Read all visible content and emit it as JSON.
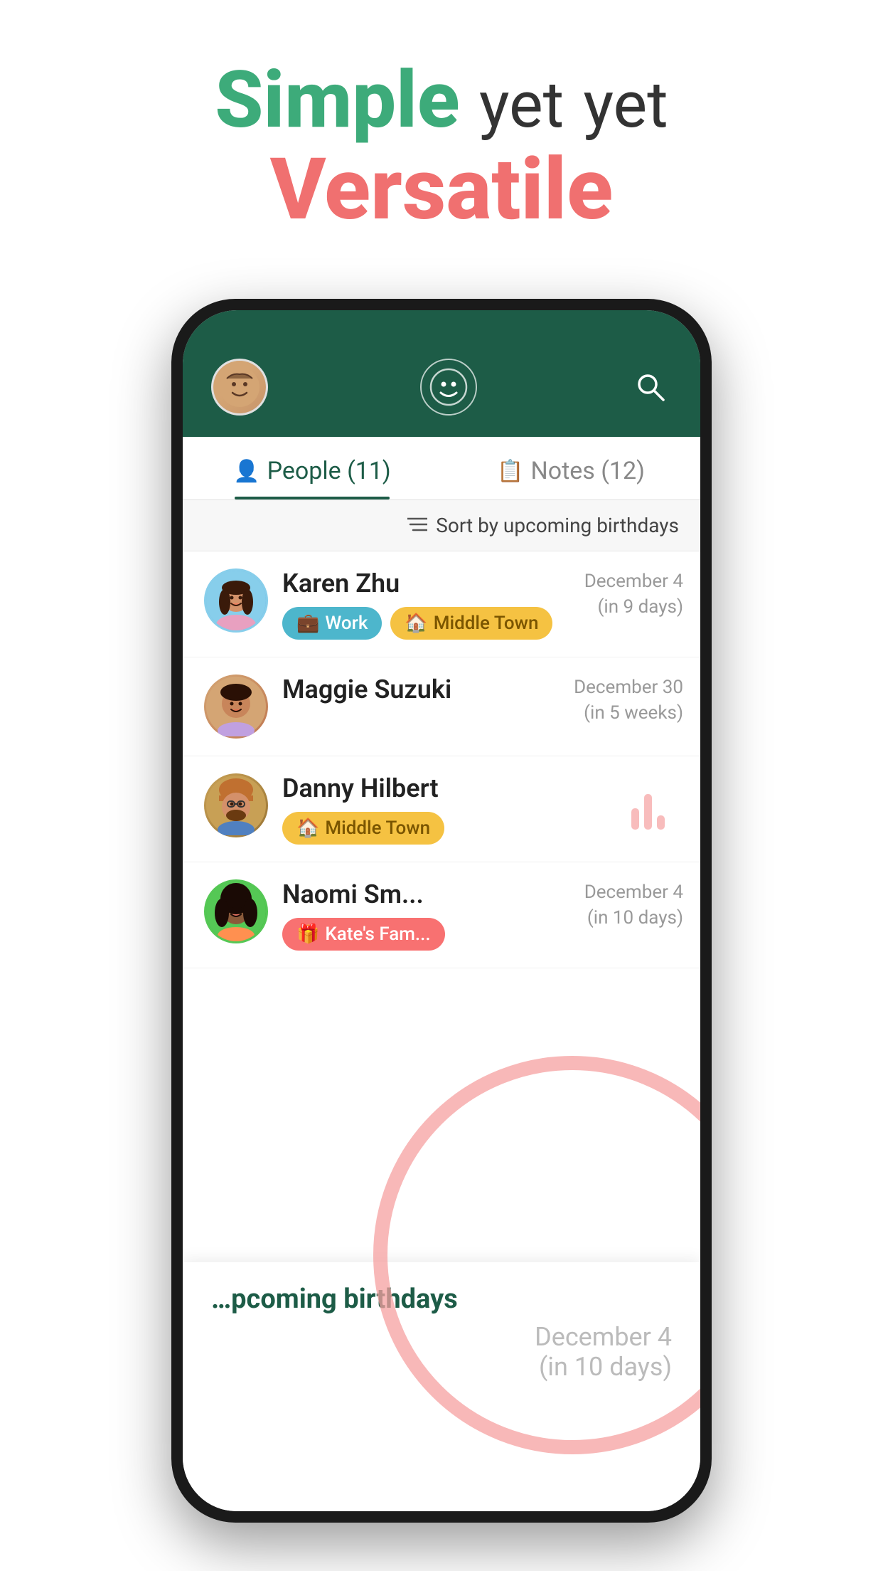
{
  "hero": {
    "line1_simple": "Simple",
    "line1_yet": "yet",
    "line2": "Versatile"
  },
  "header": {
    "search_icon": "🔍",
    "logo_icon": "😊"
  },
  "tabs": [
    {
      "label": "People (11)",
      "icon": "👤",
      "active": true
    },
    {
      "label": "Notes (12)",
      "icon": "📋",
      "active": false
    }
  ],
  "sort": {
    "label": "Sort by upcoming birthdays",
    "icon": "≡"
  },
  "contacts": [
    {
      "name": "Karen Zhu",
      "tags": [
        {
          "type": "work",
          "label": "Work",
          "icon": "💼"
        },
        {
          "type": "town",
          "label": "Middle Town",
          "icon": "🏠"
        }
      ],
      "date": "December 4",
      "days": "(in 9 days)"
    },
    {
      "name": "Maggie Suzuki",
      "tags": [],
      "date": "December 30",
      "days": "(in 5 weeks)"
    },
    {
      "name": "Danny Hilbert",
      "tags": [
        {
          "type": "town",
          "label": "Middle Town",
          "icon": "🏠"
        }
      ],
      "date": "",
      "days": ""
    },
    {
      "name": "Naomi Sm...",
      "tags": [
        {
          "type": "family",
          "label": "Kate's Fam...",
          "icon": "🎁"
        }
      ],
      "date": "December 4",
      "days": "(in 10 days)"
    }
  ],
  "tooltip": {
    "title": "pcoming birthdays",
    "date_line1": "December 4",
    "date_line2": "(in 10 days)"
  }
}
